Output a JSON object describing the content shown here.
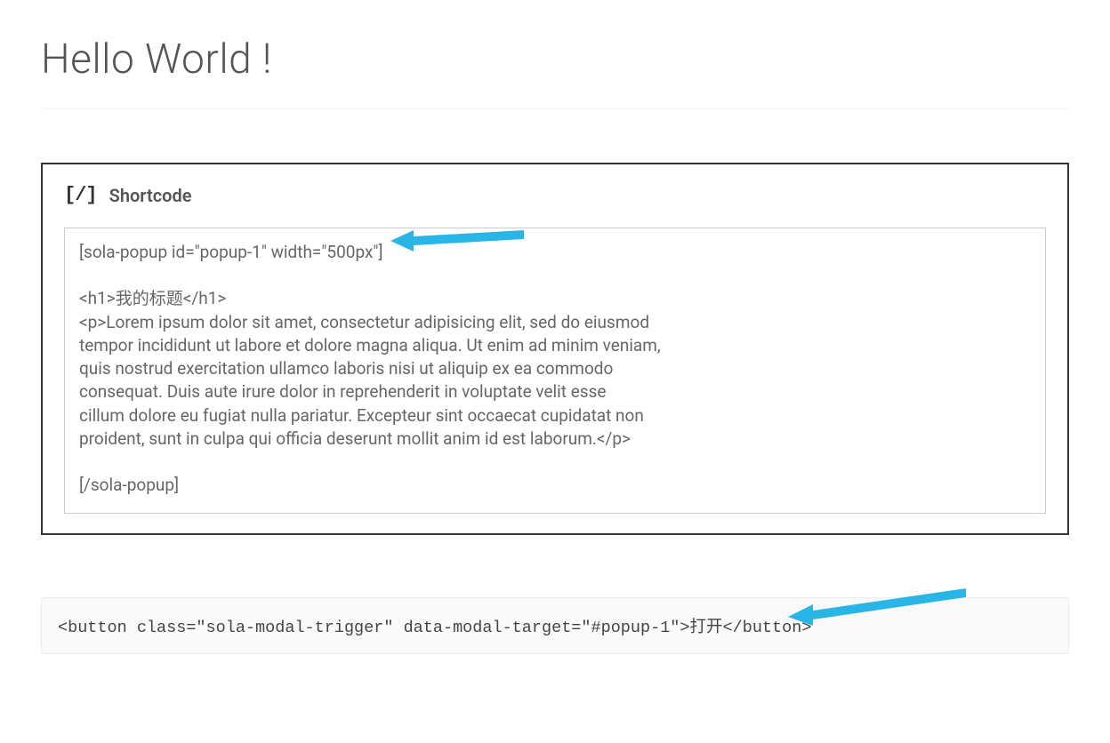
{
  "page": {
    "title": "Hello World !"
  },
  "widget": {
    "icon_text": "[/]",
    "label": "Shortcode",
    "content": "[sola-popup id=\"popup-1\" width=\"500px\"]\n\n<h1>我的标题</h1>\n<p>Lorem ipsum dolor sit amet, consectetur adipisicing elit, sed do eiusmod\ntempor incididunt ut labore et dolore magna aliqua. Ut enim ad minim veniam,\nquis nostrud exercitation ullamco laboris nisi ut aliquip ex ea commodo\nconsequat. Duis aute irure dolor in reprehenderit in voluptate velit esse\ncillum dolore eu fugiat nulla pariatur. Excepteur sint occaecat cupidatat non\nproident, sunt in culpa qui officia deserunt mollit anim id est laborum.</p>\n\n[/sola-popup]"
  },
  "snippet": {
    "code": "<button class=\"sola-modal-trigger\" data-modal-target=\"#popup-1\">打开</button>"
  },
  "colors": {
    "arrow": "#29b6e7"
  }
}
